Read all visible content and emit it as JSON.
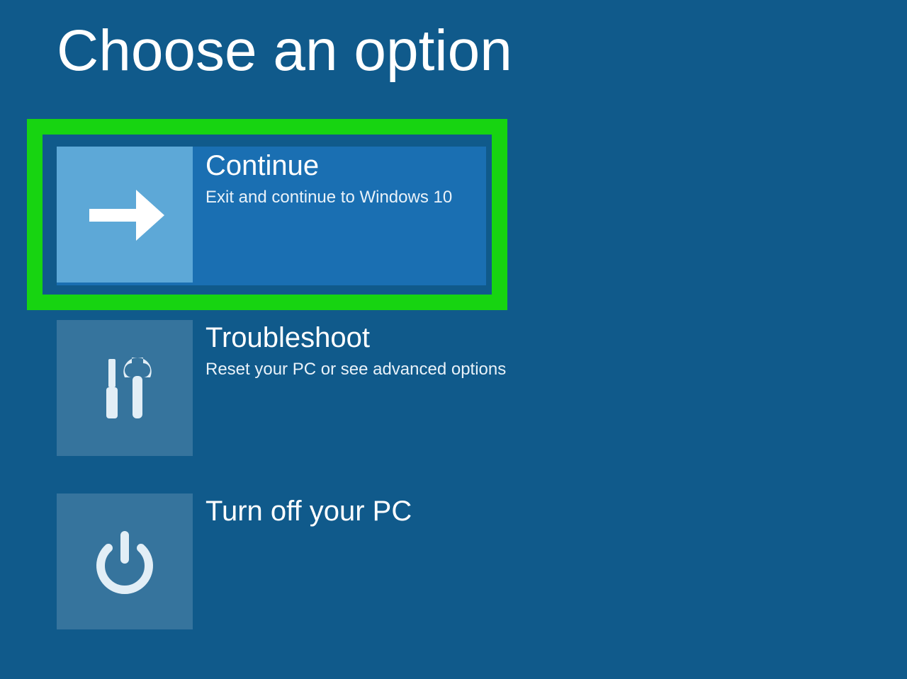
{
  "page": {
    "title": "Choose an option"
  },
  "options": {
    "continue": {
      "title": "Continue",
      "desc": "Exit and continue to Windows 10"
    },
    "troubleshoot": {
      "title": "Troubleshoot",
      "desc": "Reset your PC or see advanced options"
    },
    "turnoff": {
      "title": "Turn off your PC"
    }
  },
  "colors": {
    "background": "#105a8b",
    "highlight_border": "#17d411",
    "selected_tile_bg": "#1a6fb2",
    "selected_icon_bg": "#5da8d7"
  }
}
